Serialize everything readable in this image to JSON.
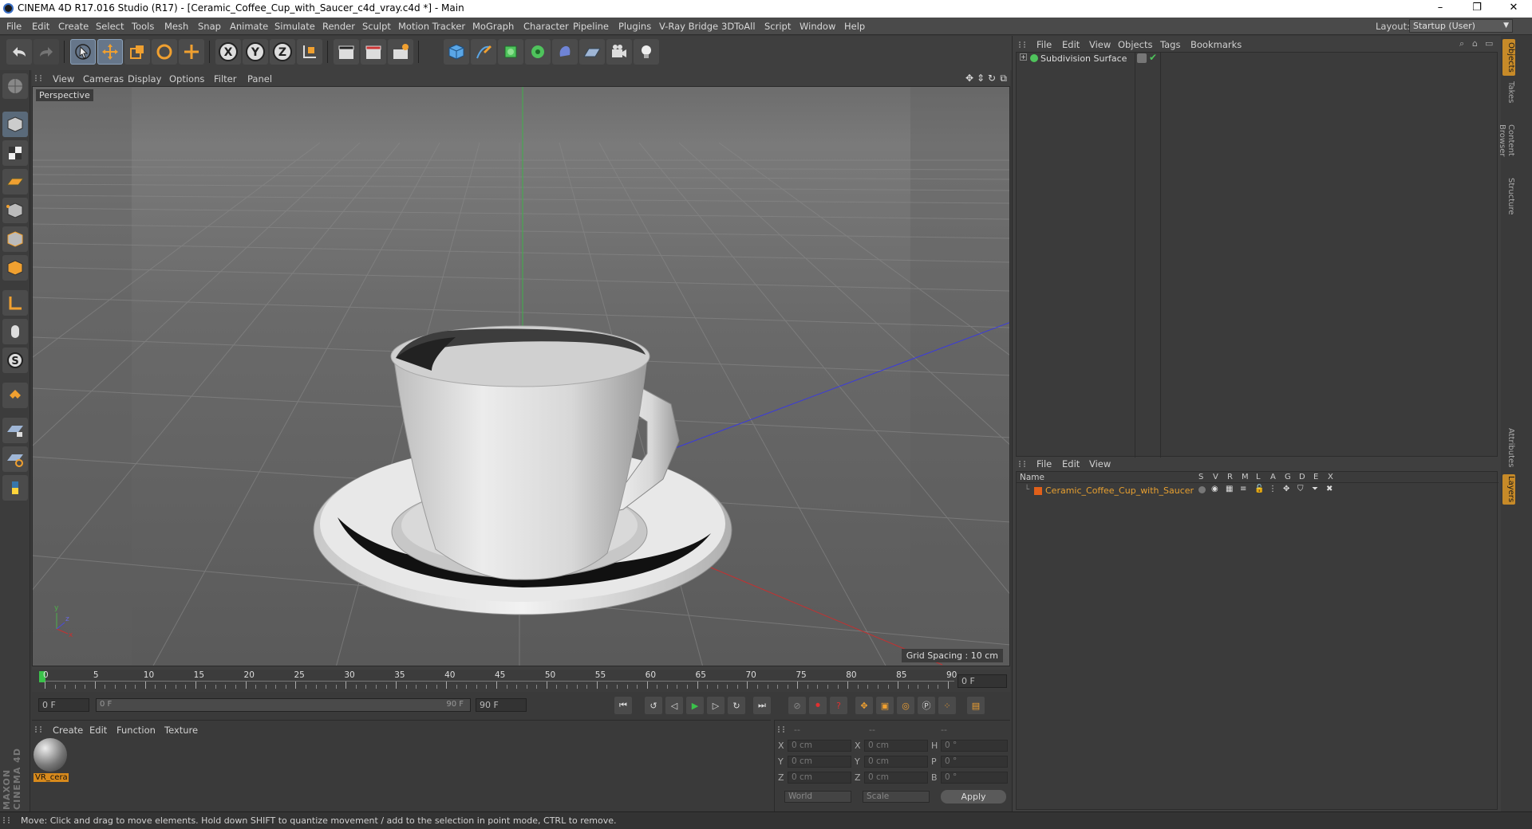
{
  "window": {
    "title": "CINEMA 4D R17.016 Studio (R17) - [Ceramic_Coffee_Cup_with_Saucer_c4d_vray.c4d *] - Main",
    "minimize": "–",
    "restore": "❐",
    "close": "✕"
  },
  "menubar": {
    "items": [
      "File",
      "Edit",
      "Create",
      "Select",
      "Tools",
      "Mesh",
      "Snap",
      "Animate",
      "Simulate",
      "Render",
      "Sculpt",
      "Motion Tracker",
      "MoGraph",
      "Character",
      "Pipeline",
      "Plugins",
      "V-Ray Bridge",
      "3DToAll",
      "Script",
      "Window",
      "Help"
    ],
    "layout_label": "Layout:",
    "layout_value": "Startup (User)"
  },
  "viewport": {
    "menu": [
      "View",
      "Cameras",
      "Display",
      "Options",
      "Filter",
      "Panel"
    ],
    "camera_label": "Perspective",
    "grid_spacing": "Grid Spacing : 10 cm"
  },
  "timeline": {
    "ticks": [
      "0",
      "5",
      "10",
      "15",
      "20",
      "25",
      "30",
      "35",
      "40",
      "45",
      "50",
      "55",
      "60",
      "65",
      "70",
      "75",
      "80",
      "85",
      "90"
    ],
    "current_frame_right": "0 F",
    "start_field": "0 F",
    "range_start": "0 F",
    "range_end": "90 F",
    "end_field": "90 F"
  },
  "material_panel": {
    "menu": [
      "Create",
      "Edit",
      "Function",
      "Texture"
    ],
    "material_name": "VR_cera"
  },
  "coordinates": {
    "headers": [
      "--",
      "--",
      "--"
    ],
    "rows": [
      {
        "a": "X",
        "av": "0 cm",
        "b": "X",
        "bv": "0 cm",
        "c": "H",
        "cv": "0 °"
      },
      {
        "a": "Y",
        "av": "0 cm",
        "b": "Y",
        "bv": "0 cm",
        "c": "P",
        "cv": "0 °"
      },
      {
        "a": "Z",
        "av": "0 cm",
        "b": "Z",
        "bv": "0 cm",
        "c": "B",
        "cv": "0 °"
      }
    ],
    "mode1": "World",
    "mode2": "Scale",
    "apply": "Apply"
  },
  "object_manager": {
    "menu": [
      "File",
      "Edit",
      "View",
      "Objects",
      "Tags",
      "Bookmarks"
    ],
    "objects": [
      "Subdivision Surface"
    ]
  },
  "layer_manager": {
    "menu": [
      "File",
      "Edit",
      "View"
    ],
    "col_name": "Name",
    "columns": [
      "S",
      "V",
      "R",
      "M",
      "L",
      "A",
      "G",
      "D",
      "E",
      "X"
    ],
    "layers": [
      "Ceramic_Coffee_Cup_with_Saucer"
    ]
  },
  "side_tabs": [
    "Objects",
    "Takes",
    "Content Browser",
    "Structure",
    "Attributes",
    "Layers"
  ],
  "brand": "MAXON CINEMA 4D",
  "status": "Move: Click and drag to move elements. Hold down SHIFT to quantize movement / add to the selection in point mode, CTRL to remove."
}
